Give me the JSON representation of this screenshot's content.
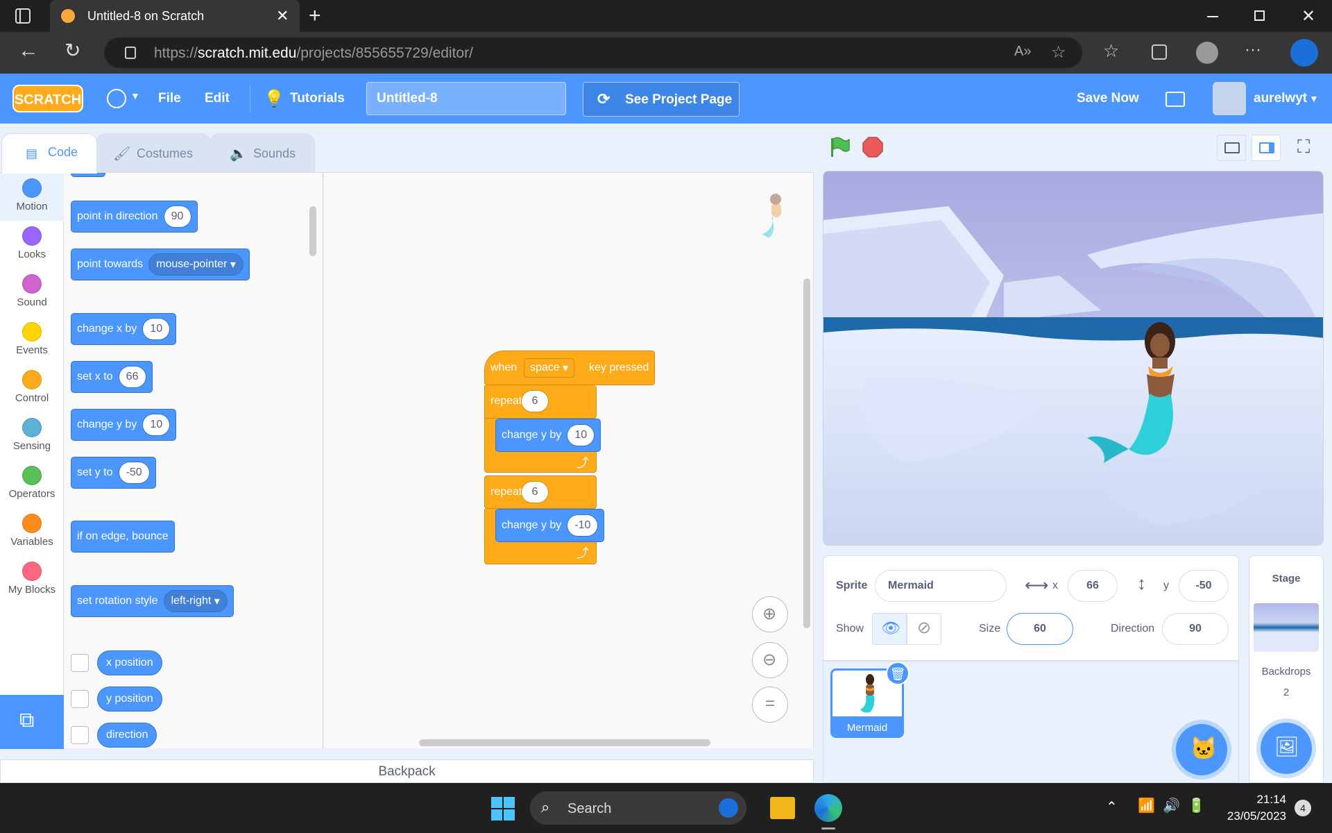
{
  "browser": {
    "tab_title": "Untitled-8 on Scratch",
    "url_prefix": "https://",
    "url_domain": "scratch.mit.edu",
    "url_path": "/projects/855655729/editor/"
  },
  "menu": {
    "logo_text": "SCRATCH",
    "file": "File",
    "edit": "Edit",
    "tutorials": "Tutorials",
    "project_title": "Untitled-8",
    "see_project_page": "See Project Page",
    "save_now": "Save Now",
    "username": "aurelwyt"
  },
  "editor_tabs": {
    "code": "Code",
    "costumes": "Costumes",
    "sounds": "Sounds"
  },
  "categories": [
    {
      "label": "Motion",
      "color": "#4c97ff"
    },
    {
      "label": "Looks",
      "color": "#9966ff"
    },
    {
      "label": "Sound",
      "color": "#cf63cf"
    },
    {
      "label": "Events",
      "color": "#ffd500"
    },
    {
      "label": "Control",
      "color": "#ffab19"
    },
    {
      "label": "Sensing",
      "color": "#5cb1d6"
    },
    {
      "label": "Operators",
      "color": "#59c059"
    },
    {
      "label": "Variables",
      "color": "#ff8c1a"
    },
    {
      "label": "My Blocks",
      "color": "#ff6680"
    }
  ],
  "palette": {
    "point_in_direction": {
      "label": "point in direction",
      "value": "90"
    },
    "point_towards": {
      "label": "point towards",
      "value": "mouse-pointer"
    },
    "change_x": {
      "label": "change x by",
      "value": "10"
    },
    "set_x": {
      "label": "set x to",
      "value": "66"
    },
    "change_y": {
      "label": "change y by",
      "value": "10"
    },
    "set_y": {
      "label": "set y to",
      "value": "-50"
    },
    "bounce": {
      "label": "if on edge, bounce"
    },
    "rotation_style": {
      "label": "set rotation style",
      "value": "left-right"
    },
    "x_position": "x position",
    "y_position": "y position",
    "direction": "direction"
  },
  "script": {
    "hat_when": "when",
    "hat_key": "space",
    "hat_suffix": "key pressed",
    "repeat1_label": "repeat",
    "repeat1_count": "6",
    "inner1_label": "change y by",
    "inner1_value": "10",
    "repeat2_label": "repeat",
    "repeat2_count": "6",
    "inner2_label": "change y by",
    "inner2_value": "-10"
  },
  "backpack": "Backpack",
  "sprite_info": {
    "sprite_label": "Sprite",
    "sprite_name": "Mermaid",
    "x_label": "x",
    "x_value": "66",
    "y_label": "y",
    "y_value": "-50",
    "show_label": "Show",
    "size_label": "Size",
    "size_value": "60",
    "direction_label": "Direction",
    "direction_value": "90"
  },
  "sprite_list": [
    {
      "name": "Mermaid"
    }
  ],
  "stage_pane": {
    "title": "Stage",
    "backdrops_label": "Backdrops",
    "backdrops_count": "2"
  },
  "taskbar": {
    "search": "Search",
    "time": "21:14",
    "date": "23/05/2023",
    "notifications": "4"
  },
  "colors": {
    "scratch_blue": "#4c97ff",
    "control_orange": "#ffab19",
    "motion_blue": "#4c97ff"
  }
}
